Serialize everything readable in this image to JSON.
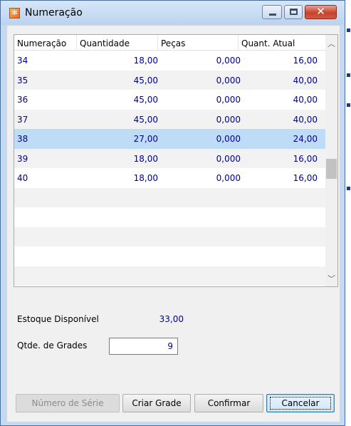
{
  "window": {
    "title": "Numeração"
  },
  "grid": {
    "columns": [
      "Numeração",
      "Quantidade",
      "Peças",
      "Quant. Atual"
    ],
    "rows": [
      {
        "numeracao": "34",
        "quantidade": "18,00",
        "pecas": "0,000",
        "quant_atual": "16,00"
      },
      {
        "numeracao": "35",
        "quantidade": "45,00",
        "pecas": "0,000",
        "quant_atual": "40,00"
      },
      {
        "numeracao": "36",
        "quantidade": "45,00",
        "pecas": "0,000",
        "quant_atual": "40,00"
      },
      {
        "numeracao": "37",
        "quantidade": "45,00",
        "pecas": "0,000",
        "quant_atual": "40,00"
      },
      {
        "numeracao": "38",
        "quantidade": "27,00",
        "pecas": "0,000",
        "quant_atual": "24,00"
      },
      {
        "numeracao": "39",
        "quantidade": "18,00",
        "pecas": "0,000",
        "quant_atual": "16,00"
      },
      {
        "numeracao": "40",
        "quantidade": "18,00",
        "pecas": "0,000",
        "quant_atual": "16,00"
      }
    ],
    "selected_row": "38"
  },
  "stock": {
    "label": "Estoque Disponível",
    "value": "33,00"
  },
  "grades": {
    "label": "Qtde. de Grades",
    "value": "9"
  },
  "buttons": {
    "serial": "Número de Série",
    "create_grid": "Criar Grade",
    "confirm": "Confirmar",
    "cancel": "Cancelar"
  },
  "colors": {
    "value_text": "#00008b",
    "selected_row": "#bfdcf7",
    "title_bar": "#c5daf1",
    "close_button": "#c6432e"
  }
}
